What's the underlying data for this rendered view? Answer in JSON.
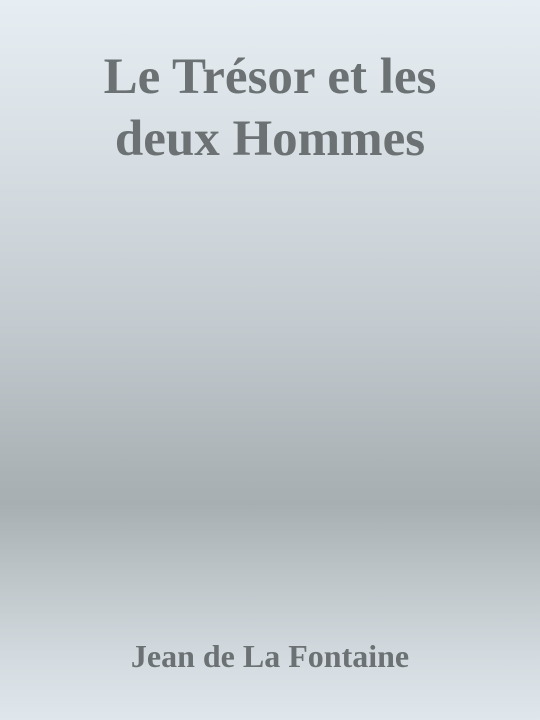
{
  "cover": {
    "title_lines": [
      "Le Trésor et les",
      "deux Hommes"
    ],
    "author": "Jean de La Fontaine",
    "text_color": "#6c7274",
    "background_top": "#e6eef3",
    "background_band": "#a7afb3",
    "background_bottom": "#dfe7ec"
  }
}
